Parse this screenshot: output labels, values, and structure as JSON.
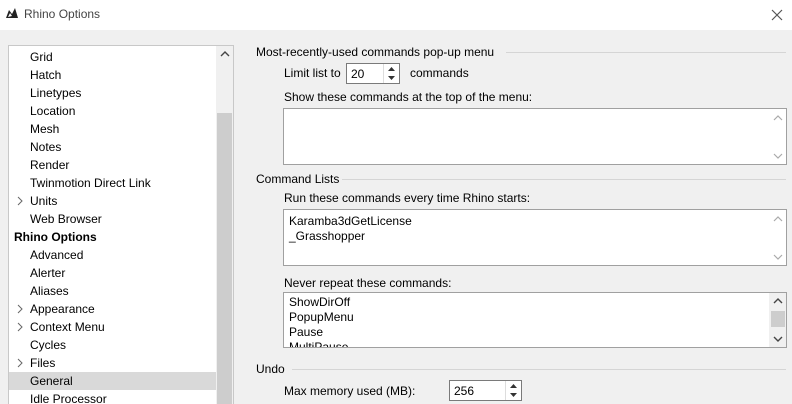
{
  "window": {
    "title": "Rhino Options"
  },
  "tree": {
    "items": [
      {
        "label": "Grid"
      },
      {
        "label": "Hatch"
      },
      {
        "label": "Linetypes"
      },
      {
        "label": "Location"
      },
      {
        "label": "Mesh"
      },
      {
        "label": "Notes"
      },
      {
        "label": "Render"
      },
      {
        "label": "Twinmotion Direct Link"
      },
      {
        "label": "Units",
        "expandable": true
      },
      {
        "label": "Web Browser"
      },
      {
        "label": "Rhino Options",
        "root": true
      },
      {
        "label": "Advanced"
      },
      {
        "label": "Alerter"
      },
      {
        "label": "Aliases"
      },
      {
        "label": "Appearance",
        "expandable": true
      },
      {
        "label": "Context Menu",
        "expandable": true
      },
      {
        "label": "Cycles"
      },
      {
        "label": "Files",
        "expandable": true
      },
      {
        "label": "General",
        "selected": true
      },
      {
        "label": "Idle Processor"
      }
    ]
  },
  "mru": {
    "title": "Most-recently-used commands pop-up menu",
    "limit_label": "Limit list to",
    "limit_value": "20",
    "limit_suffix": "commands",
    "show_top_label": "Show these commands at the top of the menu:"
  },
  "command_lists": {
    "title": "Command Lists",
    "startup_label": "Run these commands every time Rhino starts:",
    "startup_lines": [
      "Karamba3dGetLicense",
      "_Grasshopper"
    ],
    "never_repeat_label": "Never repeat these commands:",
    "never_repeat_lines": [
      "ShowDirOff",
      "PopupMenu",
      "Pause",
      "MultiPause"
    ]
  },
  "undo": {
    "title": "Undo",
    "max_memory_label": "Max memory used (MB):",
    "max_memory_value": "256"
  },
  "colors": {
    "selected_bg": "#d9d9d9",
    "background": "#f0f0f0"
  }
}
